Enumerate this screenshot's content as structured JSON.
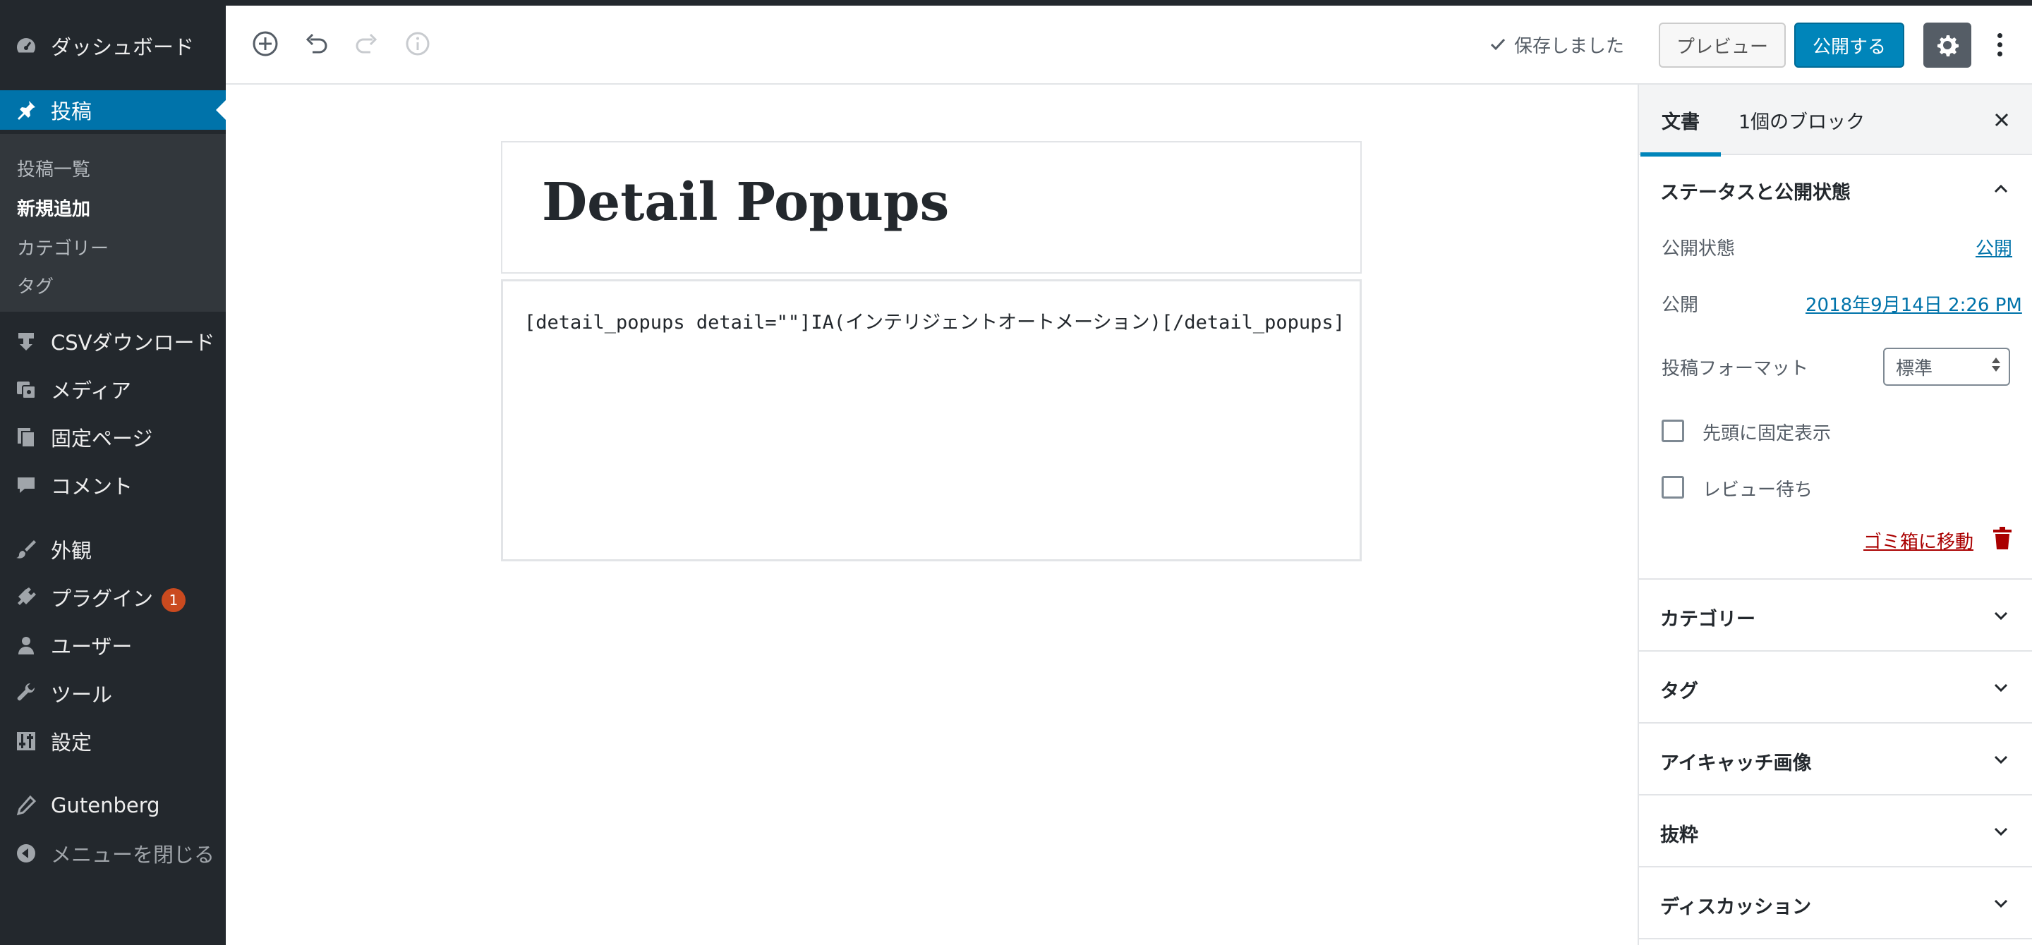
{
  "sidebar": {
    "dashboard": "ダッシュボード",
    "posts": "投稿",
    "submenu": [
      "投稿一覧",
      "新規追加",
      "カテゴリー",
      "タグ"
    ],
    "csv": "CSVダウンロード",
    "media": "メディア",
    "pages": "固定ページ",
    "comments": "コメント",
    "appearance": "外観",
    "plugins": "プラグイン",
    "plugins_badge": "1",
    "users": "ユーザー",
    "tools": "ツール",
    "settings": "設定",
    "gutenberg": "Gutenberg",
    "collapse": "メニューを閉じる"
  },
  "toolbar": {
    "saved": "保存しました",
    "preview": "プレビュー",
    "publish": "公開する"
  },
  "editor": {
    "title": "Detail Popups",
    "content": "[detail_popups detail=\"\"]IA(インテリジェントオートメーション)[/detail_popups]"
  },
  "panel": {
    "tab_document": "文書",
    "tab_block": "1個のブロック",
    "status_section": "ステータスと公開状態",
    "visibility_label": "公開状態",
    "visibility_value": "公開",
    "publish_label": "公開",
    "publish_value": "2018年9月14日 2:26 PM",
    "format_label": "投稿フォーマット",
    "format_value": "標準",
    "sticky_label": "先頭に固定表示",
    "pending_label": "レビュー待ち",
    "trash": "ゴミ箱に移動",
    "sections": [
      "カテゴリー",
      "タグ",
      "アイキャッチ画像",
      "抜粋",
      "ディスカッション"
    ]
  },
  "colors": {
    "sidebar_bg": "#23282d",
    "accent": "#0073aa",
    "publish_btn": "#0085ba",
    "trash": "#aa0000"
  }
}
